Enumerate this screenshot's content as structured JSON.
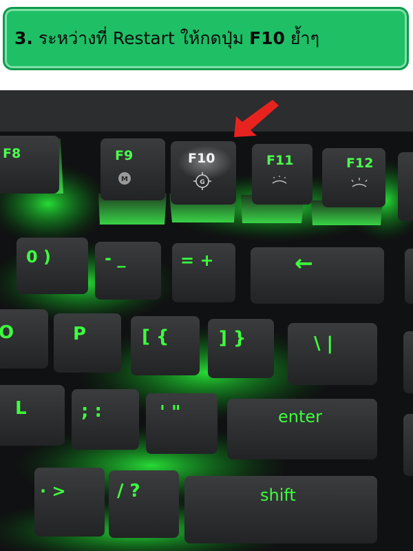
{
  "banner": {
    "step": "3.",
    "text_before": "ระหว่างที่ Restart ให้กดปุ่ม",
    "key": "F10",
    "text_after": "ย้ำๆ"
  },
  "keyboard": {
    "function_keys": [
      {
        "label": "F8",
        "icon": "none"
      },
      {
        "label": "F9",
        "icon": "macro-m-icon"
      },
      {
        "label": "F10",
        "icon": "gaming-mode-icon"
      },
      {
        "label": "F11",
        "icon": "brightness-down-icon"
      },
      {
        "label": "F12",
        "icon": "brightness-up-icon"
      }
    ],
    "number_row": [
      "0 )",
      "- _",
      "= +",
      "←"
    ],
    "top_row": [
      "O",
      "P",
      "[ {",
      "] }",
      "\\ |"
    ],
    "home_row": [
      "L",
      "; :",
      "' \"",
      "enter"
    ],
    "bottom_row": [
      "· >",
      "/ ?",
      "shift"
    ],
    "glyphs": {
      "macro": "M",
      "gaming": "G"
    }
  },
  "colors": {
    "banner_fill": "#1fbf66",
    "key_glow": "#22ff3a",
    "arrow": "#e8231f"
  }
}
